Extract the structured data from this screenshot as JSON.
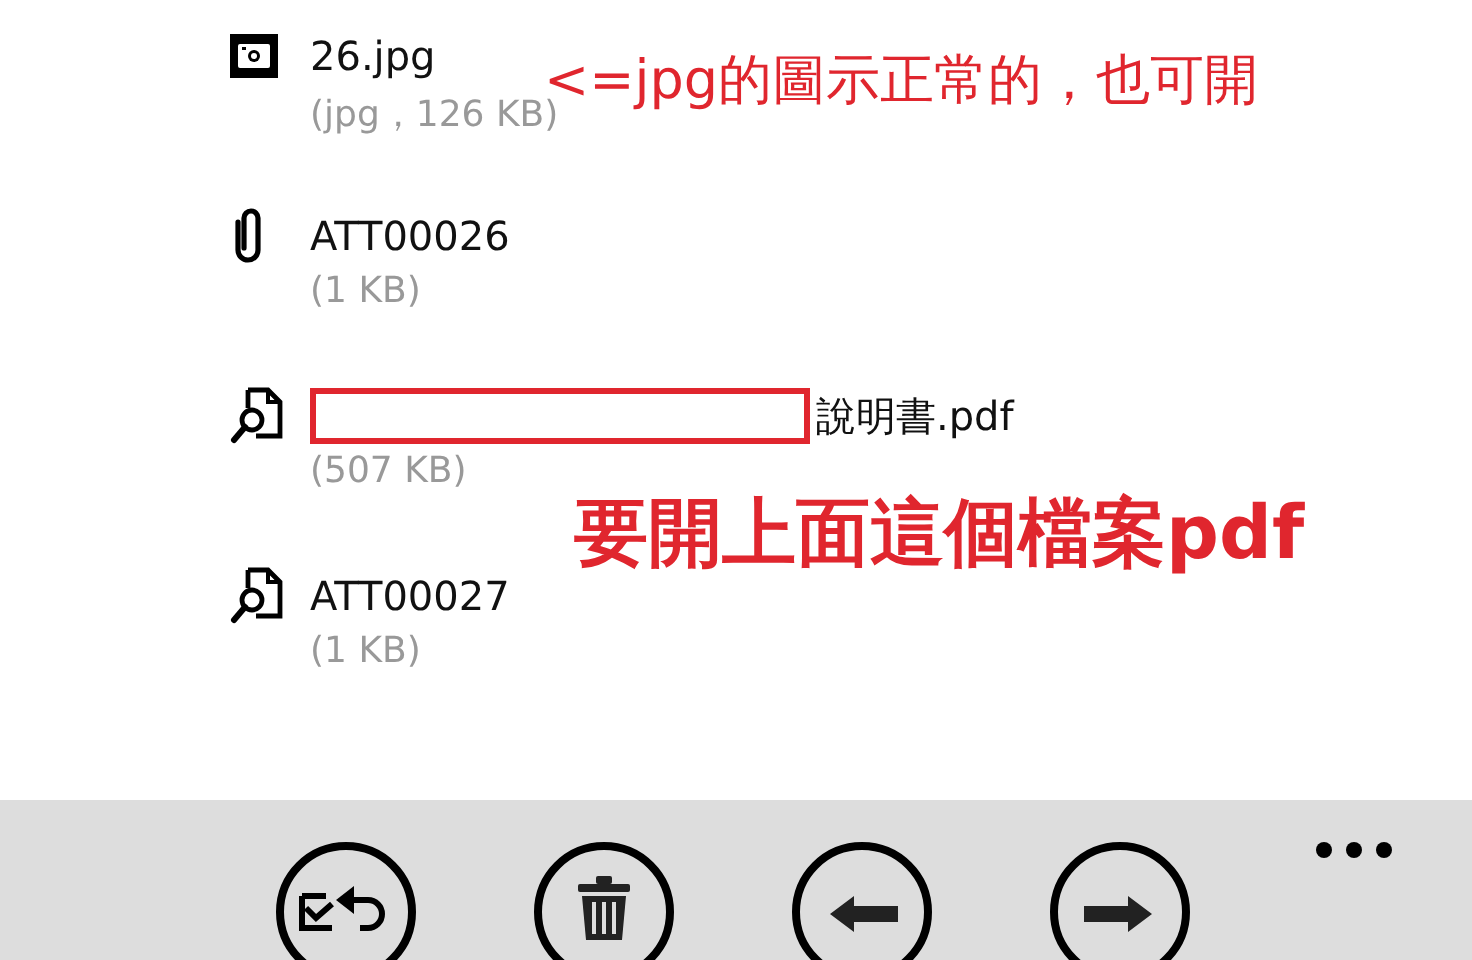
{
  "attachments": [
    {
      "kind": "image",
      "name": "26.jpg",
      "size": "(jpg，126 KB)",
      "redacted": false
    },
    {
      "kind": "clip",
      "name": "ATT00026",
      "size": "(1 KB)",
      "redacted": false
    },
    {
      "kind": "document",
      "name": "說明書.pdf",
      "size": "(507 KB)",
      "redacted": true
    },
    {
      "kind": "document",
      "name": "ATT00027",
      "size": "(1 KB)",
      "redacted": false
    }
  ],
  "annotations": [
    {
      "kind": "note",
      "text": "<=jpg的圖示正常的，也可開"
    },
    {
      "kind": "headline",
      "text": "要開上面這個檔案pdf"
    }
  ],
  "app_bar": {
    "buttons": [
      {
        "kind": "reply"
      },
      {
        "kind": "delete"
      },
      {
        "kind": "previous"
      },
      {
        "kind": "next"
      }
    ]
  }
}
